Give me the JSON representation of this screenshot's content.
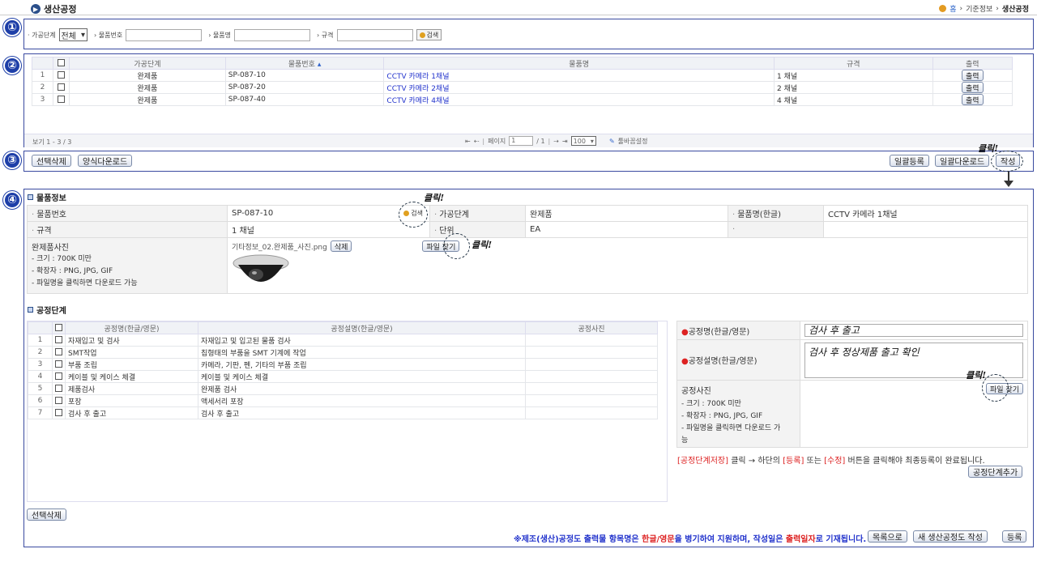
{
  "header": {
    "title": "생산공정",
    "breadcrumb": [
      "홈",
      "기준정보",
      "생산공정"
    ]
  },
  "steps": [
    "①",
    "②",
    "③",
    "④"
  ],
  "search": {
    "stage_label": "가공단계",
    "stage_value": "전체",
    "item_no_label": "물품번호",
    "item_name_label": "물품명",
    "spec_label": "규격",
    "button": "검색"
  },
  "list": {
    "headers": [
      "가공단계",
      "물품번호",
      "물품명",
      "규격",
      "출력"
    ],
    "rows": [
      {
        "no": "1",
        "stage": "완제품",
        "item_no": "SP-087-10",
        "name": "CCTV 카메라 1채널",
        "spec": "1 채널",
        "print": "출력"
      },
      {
        "no": "2",
        "stage": "완제품",
        "item_no": "SP-087-20",
        "name": "CCTV 카메라 2채널",
        "spec": "2 채널",
        "print": "출력"
      },
      {
        "no": "3",
        "stage": "완제품",
        "item_no": "SP-087-40",
        "name": "CCTV 카메라 4채널",
        "spec": "4 채널",
        "print": "출력"
      }
    ],
    "view": "보기 1 - 3 / 3",
    "page_label": "페이지",
    "page": "1",
    "total": "/ 1",
    "per_page": "100",
    "toolbar_settings": "툴바꼽설정"
  },
  "actions": {
    "delete_selected": "선택삭제",
    "form_download": "양식다운로드",
    "bulk_register": "일괄등록",
    "bulk_download": "일괄다운로드",
    "write": "작성",
    "click": "클릭!"
  },
  "item": {
    "section": "물품정보",
    "item_no_label": "물품번호",
    "item_no": "SP-087-10",
    "search": "검색",
    "stage_label": "가공단계",
    "stage": "완제품",
    "name_label": "물품명(한글)",
    "name": "CCTV 카메라 1채널",
    "spec_label": "규격",
    "spec": "1 채널",
    "unit_label": "단위",
    "unit": "EA",
    "photo_label": "완제품사진",
    "photo_notes": [
      "- 크기 : 700K 미만",
      "- 확장자 : PNG, JPG, GIF",
      "- 파일명을 클릭하면 다운로드 가능"
    ],
    "photo_file": "기타정보_02.완제품_사진.png",
    "delete": "삭제",
    "find_file": "파일 찾기"
  },
  "process": {
    "section": "공정단계",
    "headers": [
      "공정명(한글/영문)",
      "공정설명(한글/영문)",
      "공정사진"
    ],
    "rows": [
      {
        "no": "1",
        "name": "자재입고 및 검사",
        "desc": "자재입고 및 입고된 물품 검사"
      },
      {
        "no": "2",
        "name": "SMT작업",
        "desc": "칩형태의 부품을 SMT 기계에 작업"
      },
      {
        "no": "3",
        "name": "부품 조립",
        "desc": "카메라, 기판, 펜, 기타의 부품 조립"
      },
      {
        "no": "4",
        "name": "케이블 및 케이스 체결",
        "desc": "케이블 및 케이스 체결"
      },
      {
        "no": "5",
        "name": "제품검사",
        "desc": "완제품 검사"
      },
      {
        "no": "6",
        "name": "포장",
        "desc": "액세서리 포장"
      },
      {
        "no": "7",
        "name": "검사 후 출고",
        "desc": "검사 후 출고"
      }
    ],
    "delete_selected": "선택삭제",
    "form": {
      "name_label": "공정명(한글/영문)",
      "name_value": "검사 후 출고",
      "desc_label": "공정설명(한글/영문)",
      "desc_value": "검사 후 정상제품 출고 확인",
      "photo_label": "공정사진",
      "photo_notes": [
        "- 크기 : 700K 미만",
        "- 확장자 : PNG, JPG, GIF",
        "- 파일명을 클릭하면 다운로드 가",
        "능"
      ],
      "find_file": "파일 찾기"
    },
    "notice_parts": [
      "[공정단계저장]",
      "클릭 → 하단의",
      "[등록]",
      "또는",
      "[수정]",
      "버튼을 클릭해야 최종등록이 완료됩니다."
    ],
    "add_step": "공정단계추가"
  },
  "footer": {
    "notice_parts": [
      "※제조(생산)공정도 출력물 항목명은",
      "한글/영문",
      "을 병기하여 지원하며, 작성일은",
      "출력일자",
      "로 기재됩니다."
    ],
    "to_list": "목록으로",
    "new_doc": "새 생산공정도 작성",
    "register": "등록"
  }
}
